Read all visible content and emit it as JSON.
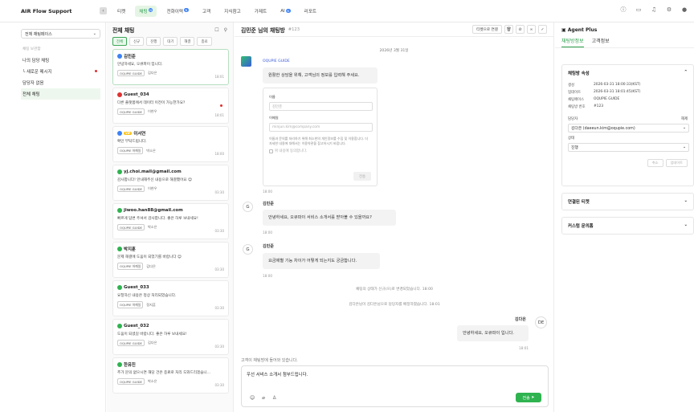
{
  "app": {
    "title": "AIR Flow Support"
  },
  "nav": {
    "items": [
      {
        "label": "티켓",
        "badge": ""
      },
      {
        "label": "채팅",
        "badge": "N"
      },
      {
        "label": "전화이력",
        "badge": "N"
      },
      {
        "label": "고객",
        "badge": ""
      },
      {
        "label": "지식참고",
        "badge": ""
      },
      {
        "label": "가제트",
        "badge": ""
      },
      {
        "label": "AI",
        "badge": "N"
      },
      {
        "label": "리포트",
        "badge": ""
      }
    ]
  },
  "sidebar": {
    "workspace": "전체 채팅페이스",
    "section": "채팅 보관함",
    "items": [
      {
        "label": "나의 담당 채팅"
      },
      {
        "label": "└ 새로운 메시지"
      },
      {
        "label": "담당자 없음"
      },
      {
        "label": "전체 채팅"
      }
    ]
  },
  "chatlist": {
    "title": "전체 채팅",
    "filters": [
      "전체",
      "신규",
      "진행",
      "대기",
      "해결",
      "종료"
    ],
    "cards": [
      {
        "name": "김민준",
        "msg": "안녕하세요, 오큐파이 입니다.",
        "tag": "OQUPIE GUIDE",
        "agent": "김다은",
        "time": "18:01",
        "dot": "#3b82f6",
        "vip": ""
      },
      {
        "name": "Guest_034",
        "msg": "다른 플랫폼에서 데이터 이전이 가능한가요?",
        "tag": "OQUPIE GUIDE",
        "agent": "이현우",
        "time": "18:01",
        "dot": "#e03131",
        "vip": ""
      },
      {
        "name": "이서연",
        "msg": "확인 부탁드립니다.",
        "tag": "OQUPIE 하께일",
        "agent": "박소은",
        "time": "18:00",
        "dot": "#3b82f6",
        "vip": "VIP"
      },
      {
        "name": "yj.choi.mail@gmail.com",
        "msg": "감사합니다! 안내해주신 내용으로 해결했어요 😊",
        "tag": "OQUPIE GUIDE",
        "agent": "이현우",
        "time": "03:30",
        "dot": "#2fb350",
        "vip": ""
      },
      {
        "name": "jiwoo.han88@gmail.com",
        "msg": "빠르게 답변 주셔서 감사합니다. 좋은 하루 보내세요!",
        "tag": "OQUPIE GUIDE",
        "agent": "박소은",
        "time": "03:30",
        "dot": "#2fb350",
        "vip": ""
      },
      {
        "name": "박지훈",
        "msg": "문제 해결에 도움이 되었기를 바랍니다 😊",
        "tag": "OQUPIE 하께일",
        "agent": "김다은",
        "time": "03:30",
        "dot": "#2fb350",
        "vip": ""
      },
      {
        "name": "Guest_033",
        "msg": "요청하신 내용은 정상 처리되었습니다.",
        "tag": "OQUPIE 하께일",
        "agent": "정지훈",
        "time": "03:30",
        "dot": "#2fb350",
        "vip": ""
      },
      {
        "name": "Guest_032",
        "msg": "도움이 되셨길 바랍니다. 좋은 하루 보내세요!",
        "tag": "OQUPIE GUIDE",
        "agent": "김다은",
        "time": "03:30",
        "dot": "#2fb350",
        "vip": ""
      },
      {
        "name": "한유진",
        "msg": "추가 문의 없으시면 해당 건은 종료로 처리 도와드리겠습니...",
        "tag": "OQUPIE GUIDE",
        "agent": "박소은",
        "time": "03:30",
        "dot": "#2fb350",
        "vip": ""
      }
    ]
  },
  "chat": {
    "title": "김민준 님의 채팅방",
    "id": "#123",
    "link_ticket": "티켓으로 연결",
    "date": "2026년 3월 31일",
    "bot_name": "OQUPIE GUIDE",
    "bot_msg": "원활한 상담을 위해, 고객님의 정보를 입력해 주세요.",
    "form": {
      "name_label": "이름",
      "name_placeholder": "김민준",
      "email_label": "이메일",
      "email_placeholder": "minjun.kim@company.com",
      "note": "이름과 문의를 처리하기 위해 최소한의 개인정보를 수집 및 이용합니다. 더 자세한 내용에 대해서는 이용약관을 참고하시기 바랍니다.",
      "agree": "위 내용에 동의합니다.",
      "submit": "전송"
    },
    "t1": "18:00",
    "u1_name": "김민준",
    "u1_msg": "안녕하세요, 오큐파이 서비스 소개서를 받아볼 수 있을까요?",
    "t2": "18:00",
    "u2_name": "김민준",
    "u2_msg": "요금제별 기능 차이가 어떻게 되는지도 궁금합니다.",
    "t3": "18:00",
    "sys1": "채팅의 상태가 신규(으)로 변경되었습니다.   18:00",
    "sys2": "김다은님이 김다은님으로 담당자를 배정하였습니다.   18:01",
    "agent_name": "김다은",
    "agent_initials": "DE",
    "user_initial": "G",
    "agent_msg": "안녕하세요, 오큐파이 입니다.",
    "t4": "18:01",
    "composer_note": "고객이 채팅방에 들어와 있습니다.",
    "composer_text": "우선 서비스 소개서 첨부드립니다.",
    "send": "전송"
  },
  "rpanel": {
    "title": "Agent Plus",
    "tabs": [
      "채팅방정보",
      "고객정보"
    ],
    "attr_title": "채팅방 속성",
    "attrs": [
      {
        "k": "생성",
        "v": "2026-03-31 18:00:33(KST)"
      },
      {
        "k": "업데이트",
        "v": "2026-03-31 18:01:45(KST)"
      },
      {
        "k": "채팅페이스",
        "v": "OQUPIE GUIDE"
      },
      {
        "k": "채팅방 번호",
        "v": "#123"
      }
    ],
    "assignee_label": "담당자",
    "assignee_action": "해제",
    "assignee": "김다은 (daeeun.kim@oqupie.com)",
    "status_label": "상태",
    "status": "진행",
    "cancel": "취소",
    "update": "업데이트",
    "linked_ticket": "연결된 티켓",
    "custom_inquiry": "커스텀 문의폼"
  }
}
